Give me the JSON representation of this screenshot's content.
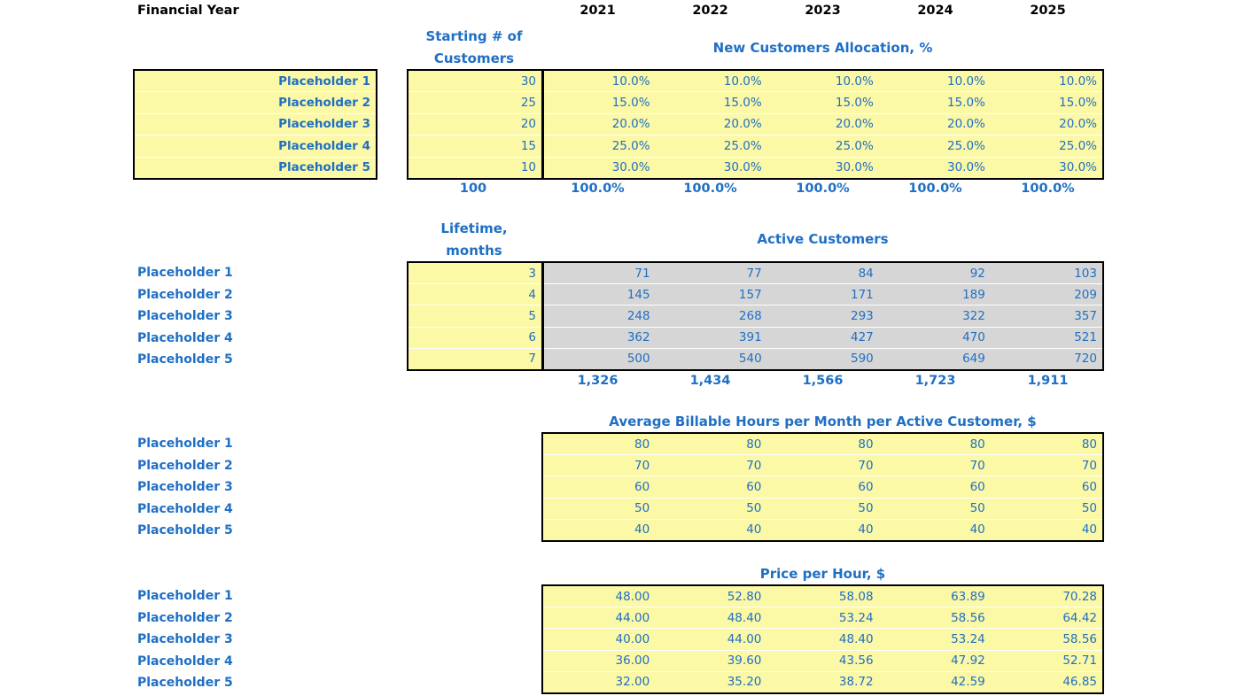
{
  "sheet": {
    "title": "Financial Year",
    "years": [
      "2021",
      "2022",
      "2023",
      "2024",
      "2025"
    ],
    "row_labels": [
      "Placeholder 1",
      "Placeholder 2",
      "Placeholder 3",
      "Placeholder 4",
      "Placeholder 5"
    ],
    "colors": {
      "accent_blue": "#1F6FC4",
      "input_yellow": "#FBF8A6",
      "calc_grey": "#D6D6D6",
      "border_black": "#000000",
      "header_black": "#000000"
    }
  },
  "sections": [
    {
      "id": "new-customers-allocation",
      "side_title": "Starting # of\nCustomers",
      "side_title_line1": "Starting # of",
      "side_title_line2": "Customers",
      "title": "New Customers Allocation, %",
      "side_values": [
        "30",
        "25",
        "20",
        "15",
        "10"
      ],
      "side_total": "100",
      "rows": [
        [
          "10.0%",
          "10.0%",
          "10.0%",
          "10.0%",
          "10.0%"
        ],
        [
          "15.0%",
          "15.0%",
          "15.0%",
          "15.0%",
          "15.0%"
        ],
        [
          "20.0%",
          "20.0%",
          "20.0%",
          "20.0%",
          "20.0%"
        ],
        [
          "25.0%",
          "25.0%",
          "25.0%",
          "25.0%",
          "25.0%"
        ],
        [
          "30.0%",
          "30.0%",
          "30.0%",
          "30.0%",
          "30.0%"
        ]
      ],
      "totals": [
        "100.0%",
        "100.0%",
        "100.0%",
        "100.0%",
        "100.0%"
      ]
    },
    {
      "id": "active-customers",
      "side_title_line1": "Lifetime,",
      "side_title_line2": "months",
      "title": "Active Customers",
      "side_values": [
        "3",
        "4",
        "5",
        "6",
        "7"
      ],
      "rows": [
        [
          "71",
          "77",
          "84",
          "92",
          "103"
        ],
        [
          "145",
          "157",
          "171",
          "189",
          "209"
        ],
        [
          "248",
          "268",
          "293",
          "322",
          "357"
        ],
        [
          "362",
          "391",
          "427",
          "470",
          "521"
        ],
        [
          "500",
          "540",
          "590",
          "649",
          "720"
        ]
      ],
      "totals": [
        "1,326",
        "1,434",
        "1,566",
        "1,723",
        "1,911"
      ]
    },
    {
      "id": "billable-hours",
      "title": "Average Billable Hours per Month per Active Customer, $",
      "rows": [
        [
          "80",
          "80",
          "80",
          "80",
          "80"
        ],
        [
          "70",
          "70",
          "70",
          "70",
          "70"
        ],
        [
          "60",
          "60",
          "60",
          "60",
          "60"
        ],
        [
          "50",
          "50",
          "50",
          "50",
          "50"
        ],
        [
          "40",
          "40",
          "40",
          "40",
          "40"
        ]
      ]
    },
    {
      "id": "price-per-hour",
      "title": "Price per Hour, $",
      "rows": [
        [
          "48.00",
          "52.80",
          "58.08",
          "63.89",
          "70.28"
        ],
        [
          "44.00",
          "48.40",
          "53.24",
          "58.56",
          "64.42"
        ],
        [
          "40.00",
          "44.00",
          "48.40",
          "53.24",
          "58.56"
        ],
        [
          "36.00",
          "39.60",
          "43.56",
          "47.92",
          "52.71"
        ],
        [
          "32.00",
          "35.20",
          "38.72",
          "42.59",
          "46.85"
        ]
      ]
    }
  ]
}
